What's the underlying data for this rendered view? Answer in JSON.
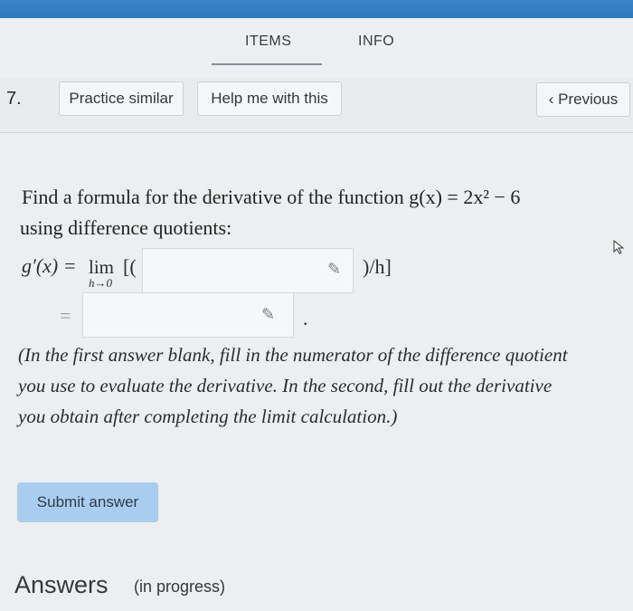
{
  "tabs": {
    "items": "ITEMS",
    "info": "INFO"
  },
  "question": {
    "number": "7.",
    "buttons": {
      "practice": "Practice similar",
      "help": "Help me with this",
      "previous": "Previous"
    },
    "prompt_line1": "Find a formula for the derivative of the function g(x) = 2x² − 6",
    "prompt_line2": "using difference quotients:",
    "formula_lhs": "g′(x) =",
    "limit_word": "lim",
    "limit_sub": "h→0",
    "open_bracket": "[(",
    "close_bracket": ")/h]",
    "equals": "=",
    "period": ".",
    "answer1_value": "",
    "answer2_value": "",
    "instruction_line1": "(In the first answer blank, fill in the numerator of the difference quotient",
    "instruction_line2": "you use to evaluate the derivative. In the second, fill out the derivative",
    "instruction_line3": "you obtain after completing the limit calculation.)"
  },
  "submit_label": "Submit answer",
  "answers": {
    "title": "Answers",
    "status": "(in progress)"
  },
  "colors": {
    "topbar": "#3a84c7",
    "submit_bg": "#a9cdee"
  },
  "icons": {
    "previous": "chevron-left-icon",
    "edit": "pencil-icon",
    "cursor": "mouse-pointer-icon"
  }
}
